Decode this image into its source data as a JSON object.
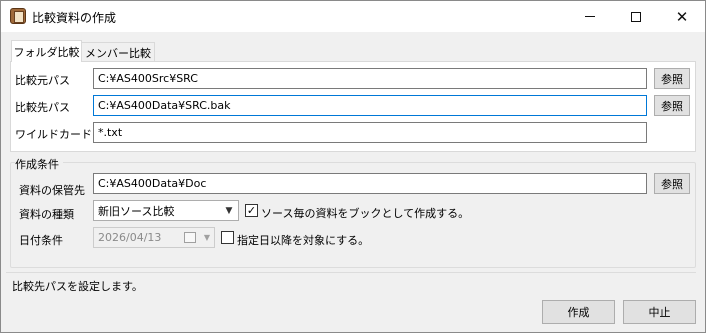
{
  "window": {
    "title": "比較資料の作成",
    "icon": "document-app-icon"
  },
  "tabs": [
    {
      "label": "フォルダ比較",
      "active": true
    },
    {
      "label": "メンバー比較",
      "active": false
    }
  ],
  "folder_compare": {
    "source_label": "比較元パス",
    "source_value": "C:¥AS400Src¥SRC",
    "target_label": "比較先パス",
    "target_value": "C:¥AS400Data¥SRC.bak",
    "wildcard_label": "ワイルドカード",
    "wildcard_value": "*.txt",
    "browse_label": "参照"
  },
  "options": {
    "group_title": "作成条件",
    "save_label": "資料の保管先",
    "save_value": "C:¥AS400Data¥Doc",
    "browse_label": "参照",
    "type_label": "資料の種類",
    "type_value": "新旧ソース比較",
    "book_checkbox_label": "ソース毎の資料をブックとして作成する。",
    "book_checked": true,
    "date_label": "日付条件",
    "date_value": "2026/04/13",
    "date_checkbox_label": "指定日以降を対象にする。",
    "date_checked": false
  },
  "status": {
    "message": "比較先パスを設定します。"
  },
  "footer": {
    "create_label": "作成",
    "cancel_label": "中止"
  },
  "caption_buttons": {
    "minimize": "minimize-icon",
    "maximize": "maximize-icon",
    "close": "close-icon"
  }
}
